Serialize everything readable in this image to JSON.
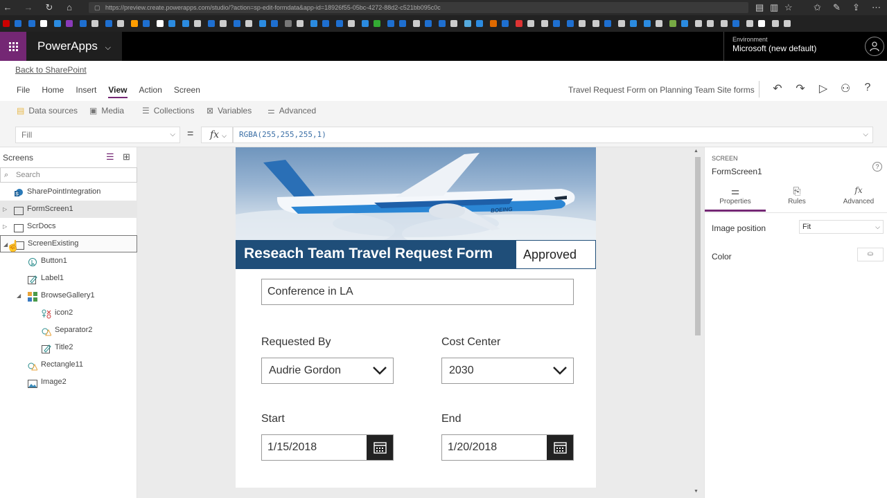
{
  "browser": {
    "url": "https://preview.create.powerapps.com/studio/?action=sp-edit-formdata&app-id=18926f55-05bc-4272-88d2-c521bb095c0c"
  },
  "header": {
    "app_name": "PowerApps",
    "environment_label": "Environment",
    "environment_value": "Microsoft (new default)"
  },
  "ribbon": {
    "back_link": "Back to SharePoint",
    "tabs": [
      "File",
      "Home",
      "Insert",
      "View",
      "Action",
      "Screen"
    ],
    "active_tab": "View",
    "doc_title": "Travel Request Form on Planning Team Site forms",
    "sub_items": [
      "Data sources",
      "Media",
      "Collections",
      "Variables",
      "Advanced"
    ]
  },
  "formula": {
    "property": "Fill",
    "equals": "=",
    "fx": "fx",
    "expression": "RGBA(255,255,255,1)"
  },
  "tree": {
    "title": "Screens",
    "search_placeholder": "Search",
    "items": [
      {
        "label": "SharePointIntegration",
        "icon": "sharepoint-icon"
      },
      {
        "label": "FormScreen1",
        "icon": "screen-icon"
      },
      {
        "label": "ScrDocs",
        "icon": "screen-icon"
      },
      {
        "label": "ScreenExisting",
        "icon": "screen-icon"
      },
      {
        "label": "Button1",
        "icon": "button-icon"
      },
      {
        "label": "Label1",
        "icon": "label-icon"
      },
      {
        "label": "BrowseGallery1",
        "icon": "gallery-icon"
      },
      {
        "label": "icon2",
        "icon": "icons-icon"
      },
      {
        "label": "Separator2",
        "icon": "shape-icon"
      },
      {
        "label": "Title2",
        "icon": "label-icon"
      },
      {
        "label": "Rectangle11",
        "icon": "shape-icon"
      },
      {
        "label": "Image2",
        "icon": "image-icon"
      }
    ]
  },
  "form": {
    "title": "Reseach Team Travel Request Form",
    "status": "Approved",
    "trip_title": "Conference in LA",
    "requested_by_label": "Requested By",
    "requested_by_value": "Audrie Gordon",
    "cost_center_label": "Cost Center",
    "cost_center_value": "2030",
    "start_label": "Start",
    "start_value": "1/15/2018",
    "end_label": "End",
    "end_value": "1/20/2018",
    "airline_text": "BOEING"
  },
  "properties": {
    "type": "SCREEN",
    "name": "FormScreen1",
    "help": "?",
    "tabs": [
      "Properties",
      "Rules",
      "Advanced"
    ],
    "image_position_label": "Image position",
    "image_position_value": "Fit",
    "color_label": "Color"
  },
  "colors": {
    "brand_purple": "#742774",
    "form_band": "#1f4e79",
    "formula_blue": "#3a6ea5"
  }
}
